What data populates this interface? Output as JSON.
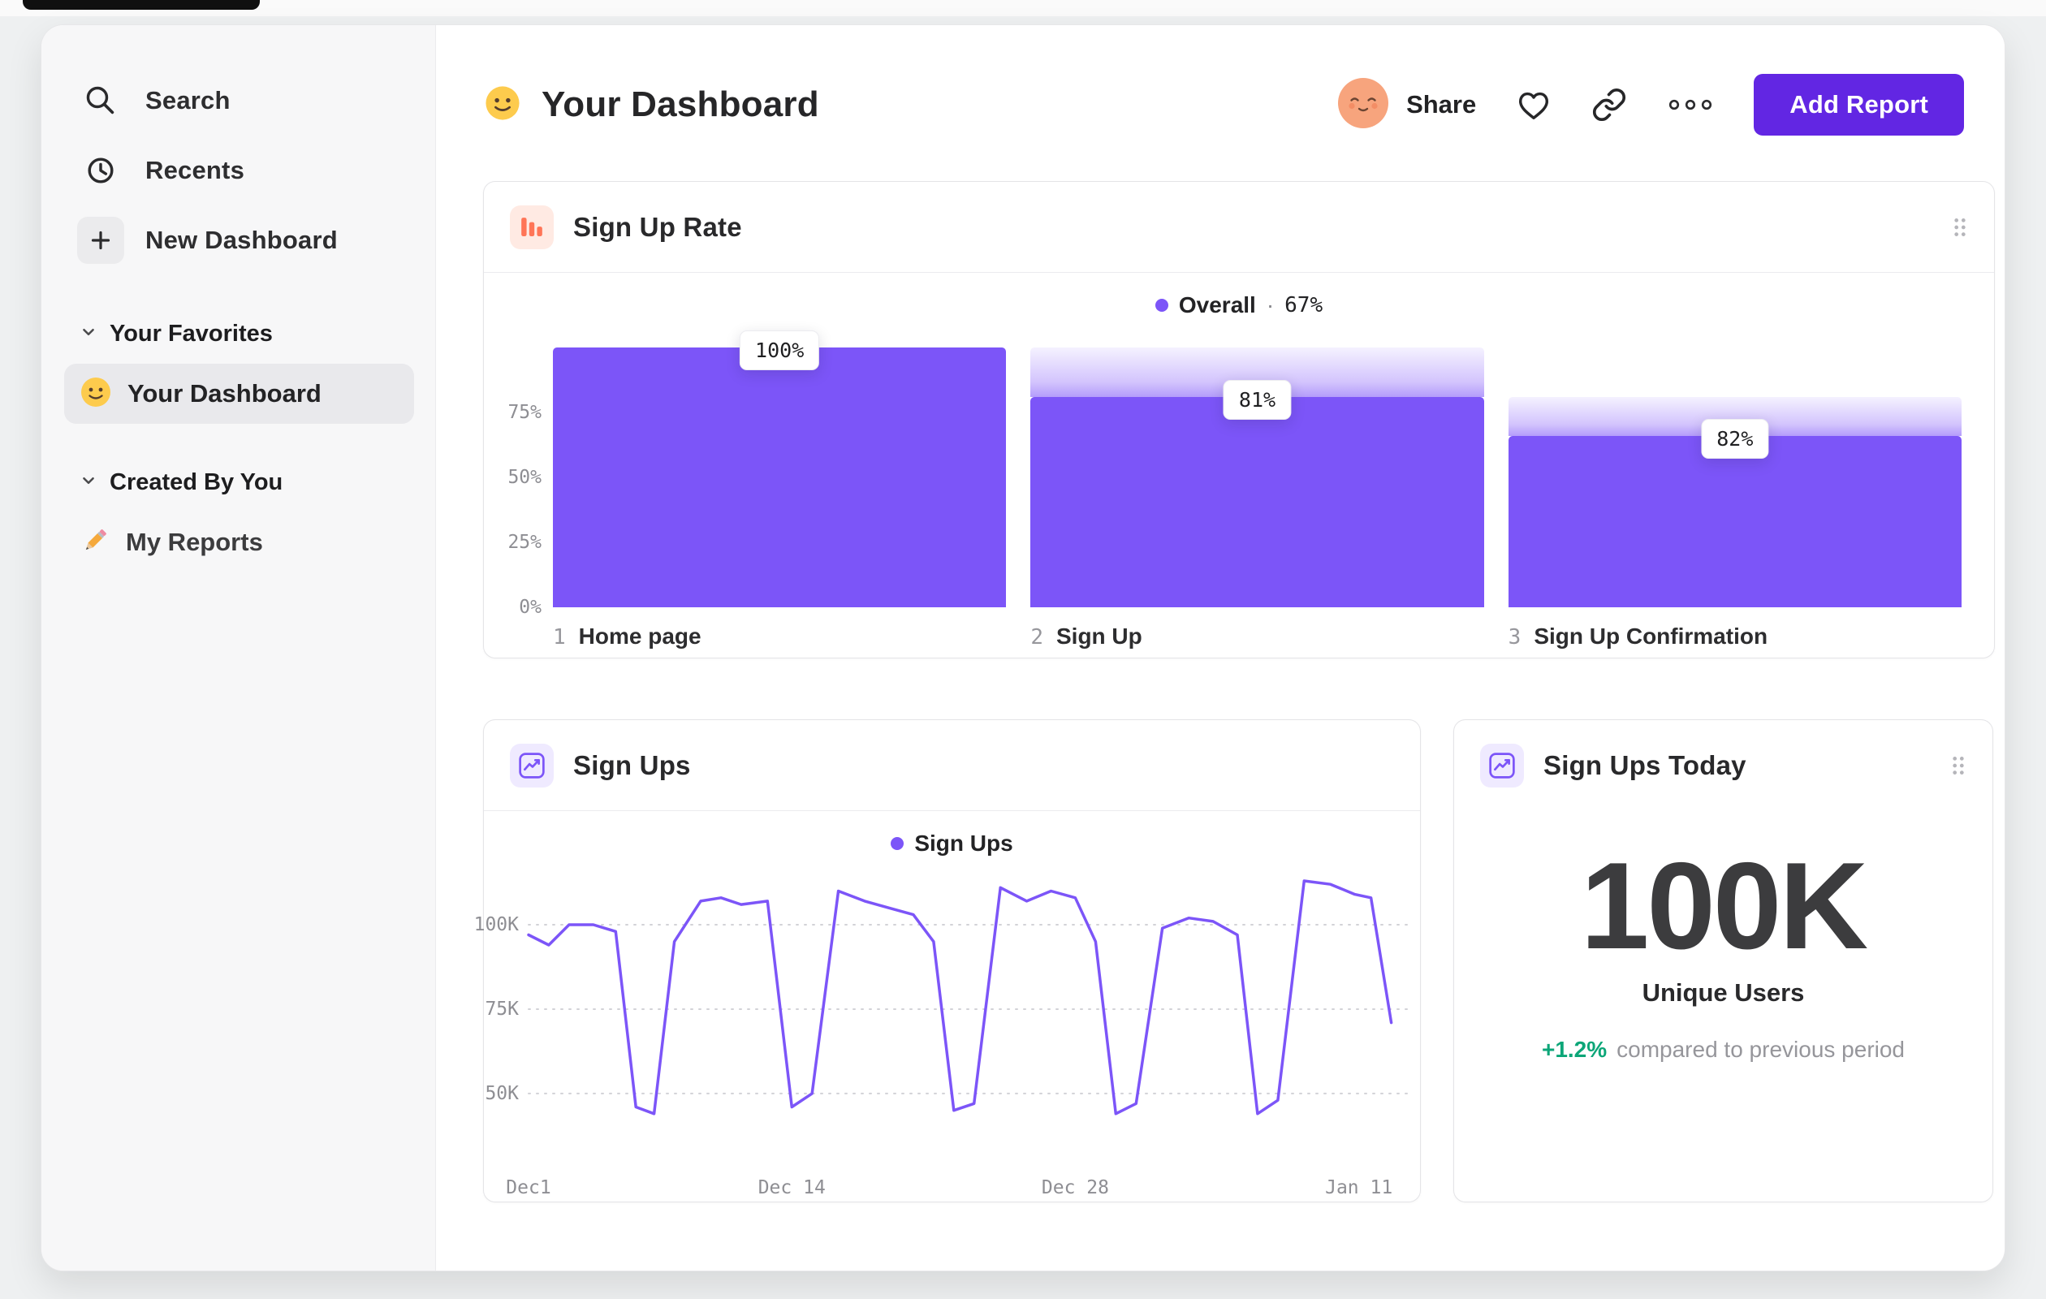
{
  "colors": {
    "purple": "#7C55F8",
    "button": "#6226E3",
    "orange": "#FF7557",
    "green": "#0CA678"
  },
  "sidebar": {
    "nav": [
      {
        "label": "Search"
      },
      {
        "label": "Recents"
      },
      {
        "label": "New Dashboard"
      }
    ],
    "sections": [
      {
        "title": "Your Favorites",
        "items": [
          {
            "label": "Your Dashboard"
          }
        ]
      },
      {
        "title": "Created By You",
        "items": [
          {
            "label": "My Reports"
          }
        ]
      }
    ]
  },
  "header": {
    "title": "Your Dashboard",
    "share": "Share",
    "add_report": "Add Report"
  },
  "chart_data": [
    {
      "id": "sign-up-rate-funnel",
      "type": "bar",
      "title": "Sign Up Rate",
      "legend": {
        "label": "Overall",
        "sep": "·",
        "value": "67%"
      },
      "y_ticks": [
        {
          "label": "75%",
          "pct": 75
        },
        {
          "label": "50%",
          "pct": 50
        },
        {
          "label": "25%",
          "pct": 25
        },
        {
          "label": "0%",
          "pct": 0
        }
      ],
      "steps": [
        {
          "num": "1",
          "name": "Home page",
          "conversion_label": "100%",
          "overall_height_pct": 100
        },
        {
          "num": "2",
          "name": "Sign Up",
          "conversion_label": "81%",
          "overall_height_pct": 81
        },
        {
          "num": "3",
          "name": "Sign Up Confirmation",
          "conversion_label": "82%",
          "overall_height_pct": 66
        }
      ]
    },
    {
      "id": "sign-ups-line",
      "type": "line",
      "title": "Sign Ups",
      "legend": {
        "label": "Sign Ups"
      },
      "y_ticks": [
        {
          "label": "100K",
          "value": 100
        },
        {
          "label": "75K",
          "value": 75
        },
        {
          "label": "50K",
          "value": 50
        }
      ],
      "x_ticks": [
        {
          "label": "Dec1",
          "day": 0
        },
        {
          "label": "Dec 14",
          "day": 13
        },
        {
          "label": "Dec 28",
          "day": 27
        },
        {
          "label": "Jan 11",
          "day": 41
        }
      ],
      "x_domain": [
        0,
        43.5
      ],
      "y_domain": [
        30,
        113
      ],
      "unit": "K",
      "points": [
        [
          0,
          97
        ],
        [
          1,
          94
        ],
        [
          2,
          100
        ],
        [
          3.2,
          100
        ],
        [
          4.3,
          98
        ],
        [
          5.3,
          46
        ],
        [
          6.2,
          44
        ],
        [
          7.2,
          95
        ],
        [
          8.5,
          107
        ],
        [
          9.5,
          108
        ],
        [
          10.5,
          106
        ],
        [
          11.8,
          107
        ],
        [
          13,
          46
        ],
        [
          14,
          50
        ],
        [
          15.3,
          110
        ],
        [
          16.6,
          107
        ],
        [
          17.8,
          105
        ],
        [
          19,
          103
        ],
        [
          20,
          95
        ],
        [
          21,
          45
        ],
        [
          22,
          47
        ],
        [
          23.3,
          111
        ],
        [
          24.6,
          107
        ],
        [
          25.8,
          110
        ],
        [
          27,
          108
        ],
        [
          28,
          95
        ],
        [
          29,
          44
        ],
        [
          30,
          47
        ],
        [
          31.3,
          99
        ],
        [
          32.6,
          102
        ],
        [
          33.8,
          101
        ],
        [
          35,
          97
        ],
        [
          36,
          44
        ],
        [
          37,
          48
        ],
        [
          38.3,
          113
        ],
        [
          39.6,
          112
        ],
        [
          40.8,
          109
        ],
        [
          41.6,
          108
        ],
        [
          42.6,
          71
        ]
      ]
    },
    {
      "id": "sign-ups-today",
      "type": "big_number",
      "title": "Sign Ups Today",
      "value": "100K",
      "label": "Unique Users",
      "delta": "+1.2%",
      "delta_note": "compared to previous period"
    }
  ]
}
